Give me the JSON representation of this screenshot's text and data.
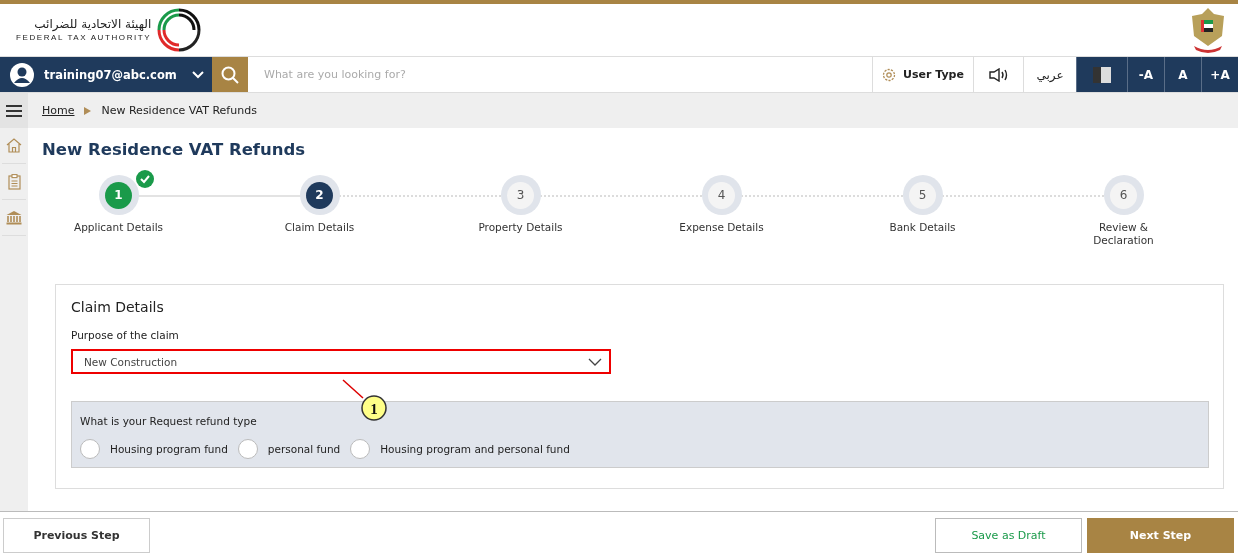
{
  "header": {
    "logo_arabic": "الهيئة الاتحادية للضرائب",
    "logo_english": "FEDERAL TAX AUTHORITY"
  },
  "nav": {
    "user": "training07@abc.com",
    "search": {
      "placeholder": "What are you looking for?"
    },
    "user_type": "User Type",
    "language": "عربي",
    "font_buttons": [
      "-A",
      "A",
      "+A"
    ]
  },
  "breadcrumb": [
    {
      "label": "Home",
      "kind": "link"
    },
    {
      "label": "New Residence VAT Refunds",
      "kind": "current"
    }
  ],
  "page_title": "New Residence VAT Refunds",
  "steps": [
    {
      "number": "1",
      "label": "Applicant Details",
      "completed": true,
      "selected": false
    },
    {
      "number": "2",
      "label": "Claim Details",
      "completed": false,
      "selected": true
    },
    {
      "number": "3",
      "label": "Property Details",
      "completed": false,
      "selected": false
    },
    {
      "number": "4",
      "label": "Expense Details",
      "completed": false,
      "selected": false
    },
    {
      "number": "5",
      "label": "Bank Details",
      "completed": false,
      "selected": false
    },
    {
      "number": "6",
      "label": "Review & Declaration",
      "completed": false,
      "selected": false
    }
  ],
  "form": {
    "title": "Claim Details",
    "purpose": {
      "label": "Purpose of the claim",
      "value": "New Construction"
    },
    "refund": {
      "question": "What is your Request refund type",
      "options": [
        {
          "label": "Housing program fund",
          "selected": false
        },
        {
          "label": "personal fund",
          "selected": false
        },
        {
          "label": "Housing program and personal fund",
          "selected": false
        }
      ]
    }
  },
  "callout": {
    "number": "1"
  },
  "footer": {
    "previous": "Previous Step",
    "draft": "Save as Draft",
    "next": "Next Step"
  }
}
